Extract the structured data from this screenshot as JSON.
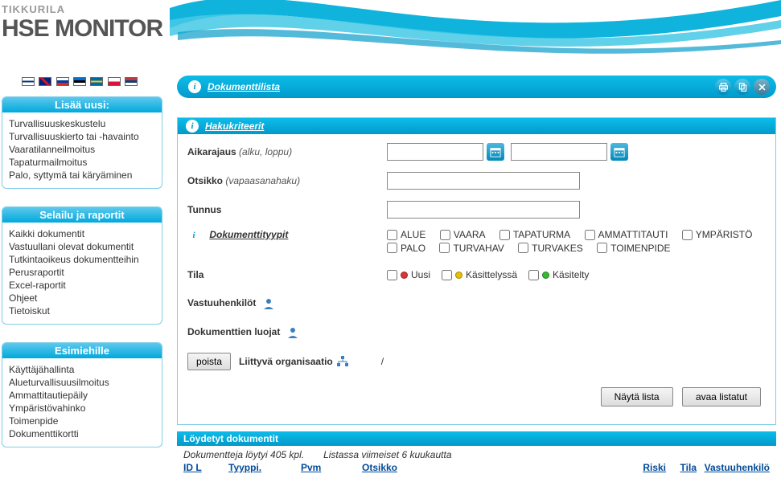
{
  "brand": {
    "company": "TIKKURILA",
    "product": "HSE MONITOR"
  },
  "titlebar": {
    "title": "Dokumenttilista"
  },
  "sidebar": {
    "lisa": {
      "title": "Lisää uusi:",
      "items": [
        "Turvallisuuskeskustelu",
        "Turvallisuuskierto tai -havainto",
        "Vaaratilanneilmoitus",
        "Tapaturmailmoitus",
        "Palo, syttymä tai käryäminen"
      ]
    },
    "selailu": {
      "title": "Selailu ja raportit",
      "items": [
        "Kaikki dokumentit",
        "Vastuullani olevat dokumentit",
        "Tutkintaoikeus dokumentteihin",
        "Perusraportit",
        "Excel-raportit",
        "Ohjeet",
        "Tietoiskut"
      ]
    },
    "esimies": {
      "title": "Esimiehille",
      "items": [
        "Käyttäjähallinta",
        "Alueturvallisuusilmoitus",
        "Ammattitautiepäily",
        "Ympäristövahinko",
        "Toimenpide",
        "Dokumenttikortti"
      ]
    }
  },
  "search": {
    "heading": "Hakukriteerit",
    "aikarajaus": "Aikarajaus",
    "aikarajaus_hint": "(alku, loppu)",
    "otsikko": "Otsikko",
    "otsikko_hint": "(vapaasanahaku)",
    "tunnus": "Tunnus",
    "tyypit": "Dokumenttityypit",
    "type_labels": [
      "ALUE",
      "VAARA",
      "TAPATURMA",
      "AMMATTITAUTI",
      "YMPÄRISTÖ",
      "PALO",
      "TURVAHAV",
      "TURVAKES",
      "TOIMENPIDE"
    ],
    "tila": "Tila",
    "tila_labels": [
      "Uusi",
      "Käsittelyssä",
      "Käsitelty"
    ],
    "vastuu": "Vastuuhenkilöt",
    "luojat": "Dokumenttien luojat",
    "poista": "poista",
    "org": "Liittyvä organisaatio",
    "org_val": "/",
    "nayta": "Näytä lista",
    "avaa": "avaa listatut"
  },
  "found": {
    "heading": "Löydetyt dokumentit",
    "count": "Dokumentteja löytyi 405 kpl.",
    "range": "Listassa viimeiset 6 kuukautta",
    "cols": {
      "id": "ID L",
      "tyyppi": "Tyyppi.",
      "pvm": "Pvm",
      "otsikko": "Otsikko",
      "riski": "Riski",
      "tila": "Tila",
      "vastuu": "Vastuuhenkilö"
    }
  }
}
